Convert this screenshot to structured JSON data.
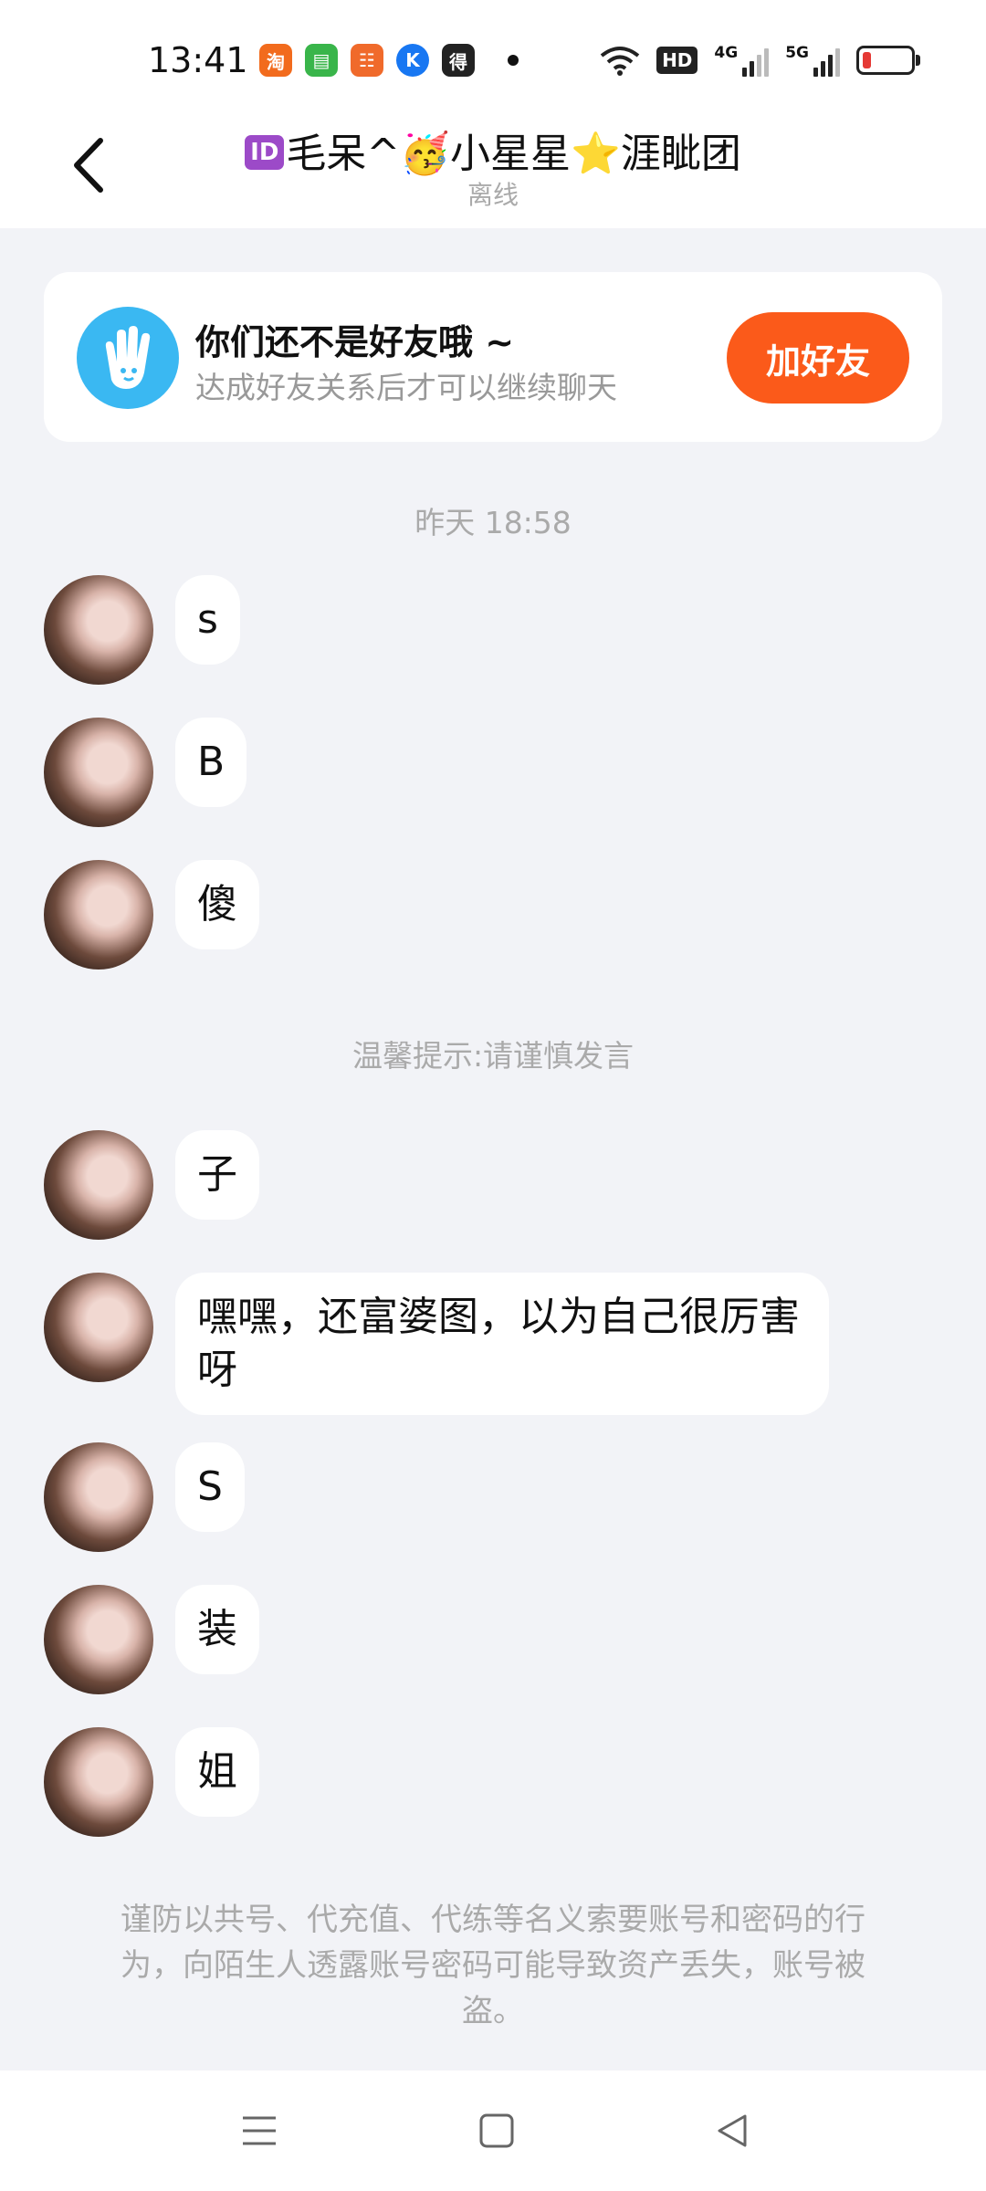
{
  "status_bar": {
    "time": "13:41",
    "apps": [
      {
        "name": "taobao-app-icon",
        "glyph": "淘",
        "color": "#f26b1d"
      },
      {
        "name": "messages-app-icon",
        "glyph": "▤",
        "color": "#39b54a"
      },
      {
        "name": "app-grid-icon",
        "glyph": "☷",
        "color": "#f06a2b"
      },
      {
        "name": "k-app-icon",
        "glyph": "K",
        "color": "#1877f2"
      },
      {
        "name": "dewu-app-icon",
        "glyph": "得",
        "color": "#222222"
      }
    ],
    "hd_label": "HD",
    "net1": "4G",
    "net2": "5G"
  },
  "header": {
    "back_icon": "chevron-left-icon",
    "title_badge": "ID",
    "title_text": "毛呆^🥳小星星⭐涯眦团",
    "subtitle": "离线"
  },
  "friend_banner": {
    "icon": "waving-hand-icon",
    "title": "你们还不是好友哦 ~",
    "subtitle": "达成好友关系后才可以继续聊天",
    "button_label": "加好友",
    "accent_color": "#fb5a1a"
  },
  "timestamp": "昨天 18:58",
  "messages_before_tip": [
    {
      "text": "s"
    },
    {
      "text": "B"
    },
    {
      "text": "傻"
    }
  ],
  "tip": "温馨提示:请谨慎发言",
  "messages_after_tip": [
    {
      "text": "子"
    },
    {
      "text": "嘿嘿，还富婆图，以为自己很厉害呀"
    },
    {
      "text": "S"
    },
    {
      "text": "装"
    },
    {
      "text": "姐"
    }
  ],
  "notice": "谨防以共号、代充值、代练等名义索要账号和密码的行为，向陌生人透露账号密码可能导致资产丢失，账号被盗。",
  "nav_bar": {
    "icons": [
      "menu-icon",
      "home-square-icon",
      "back-triangle-icon"
    ]
  }
}
